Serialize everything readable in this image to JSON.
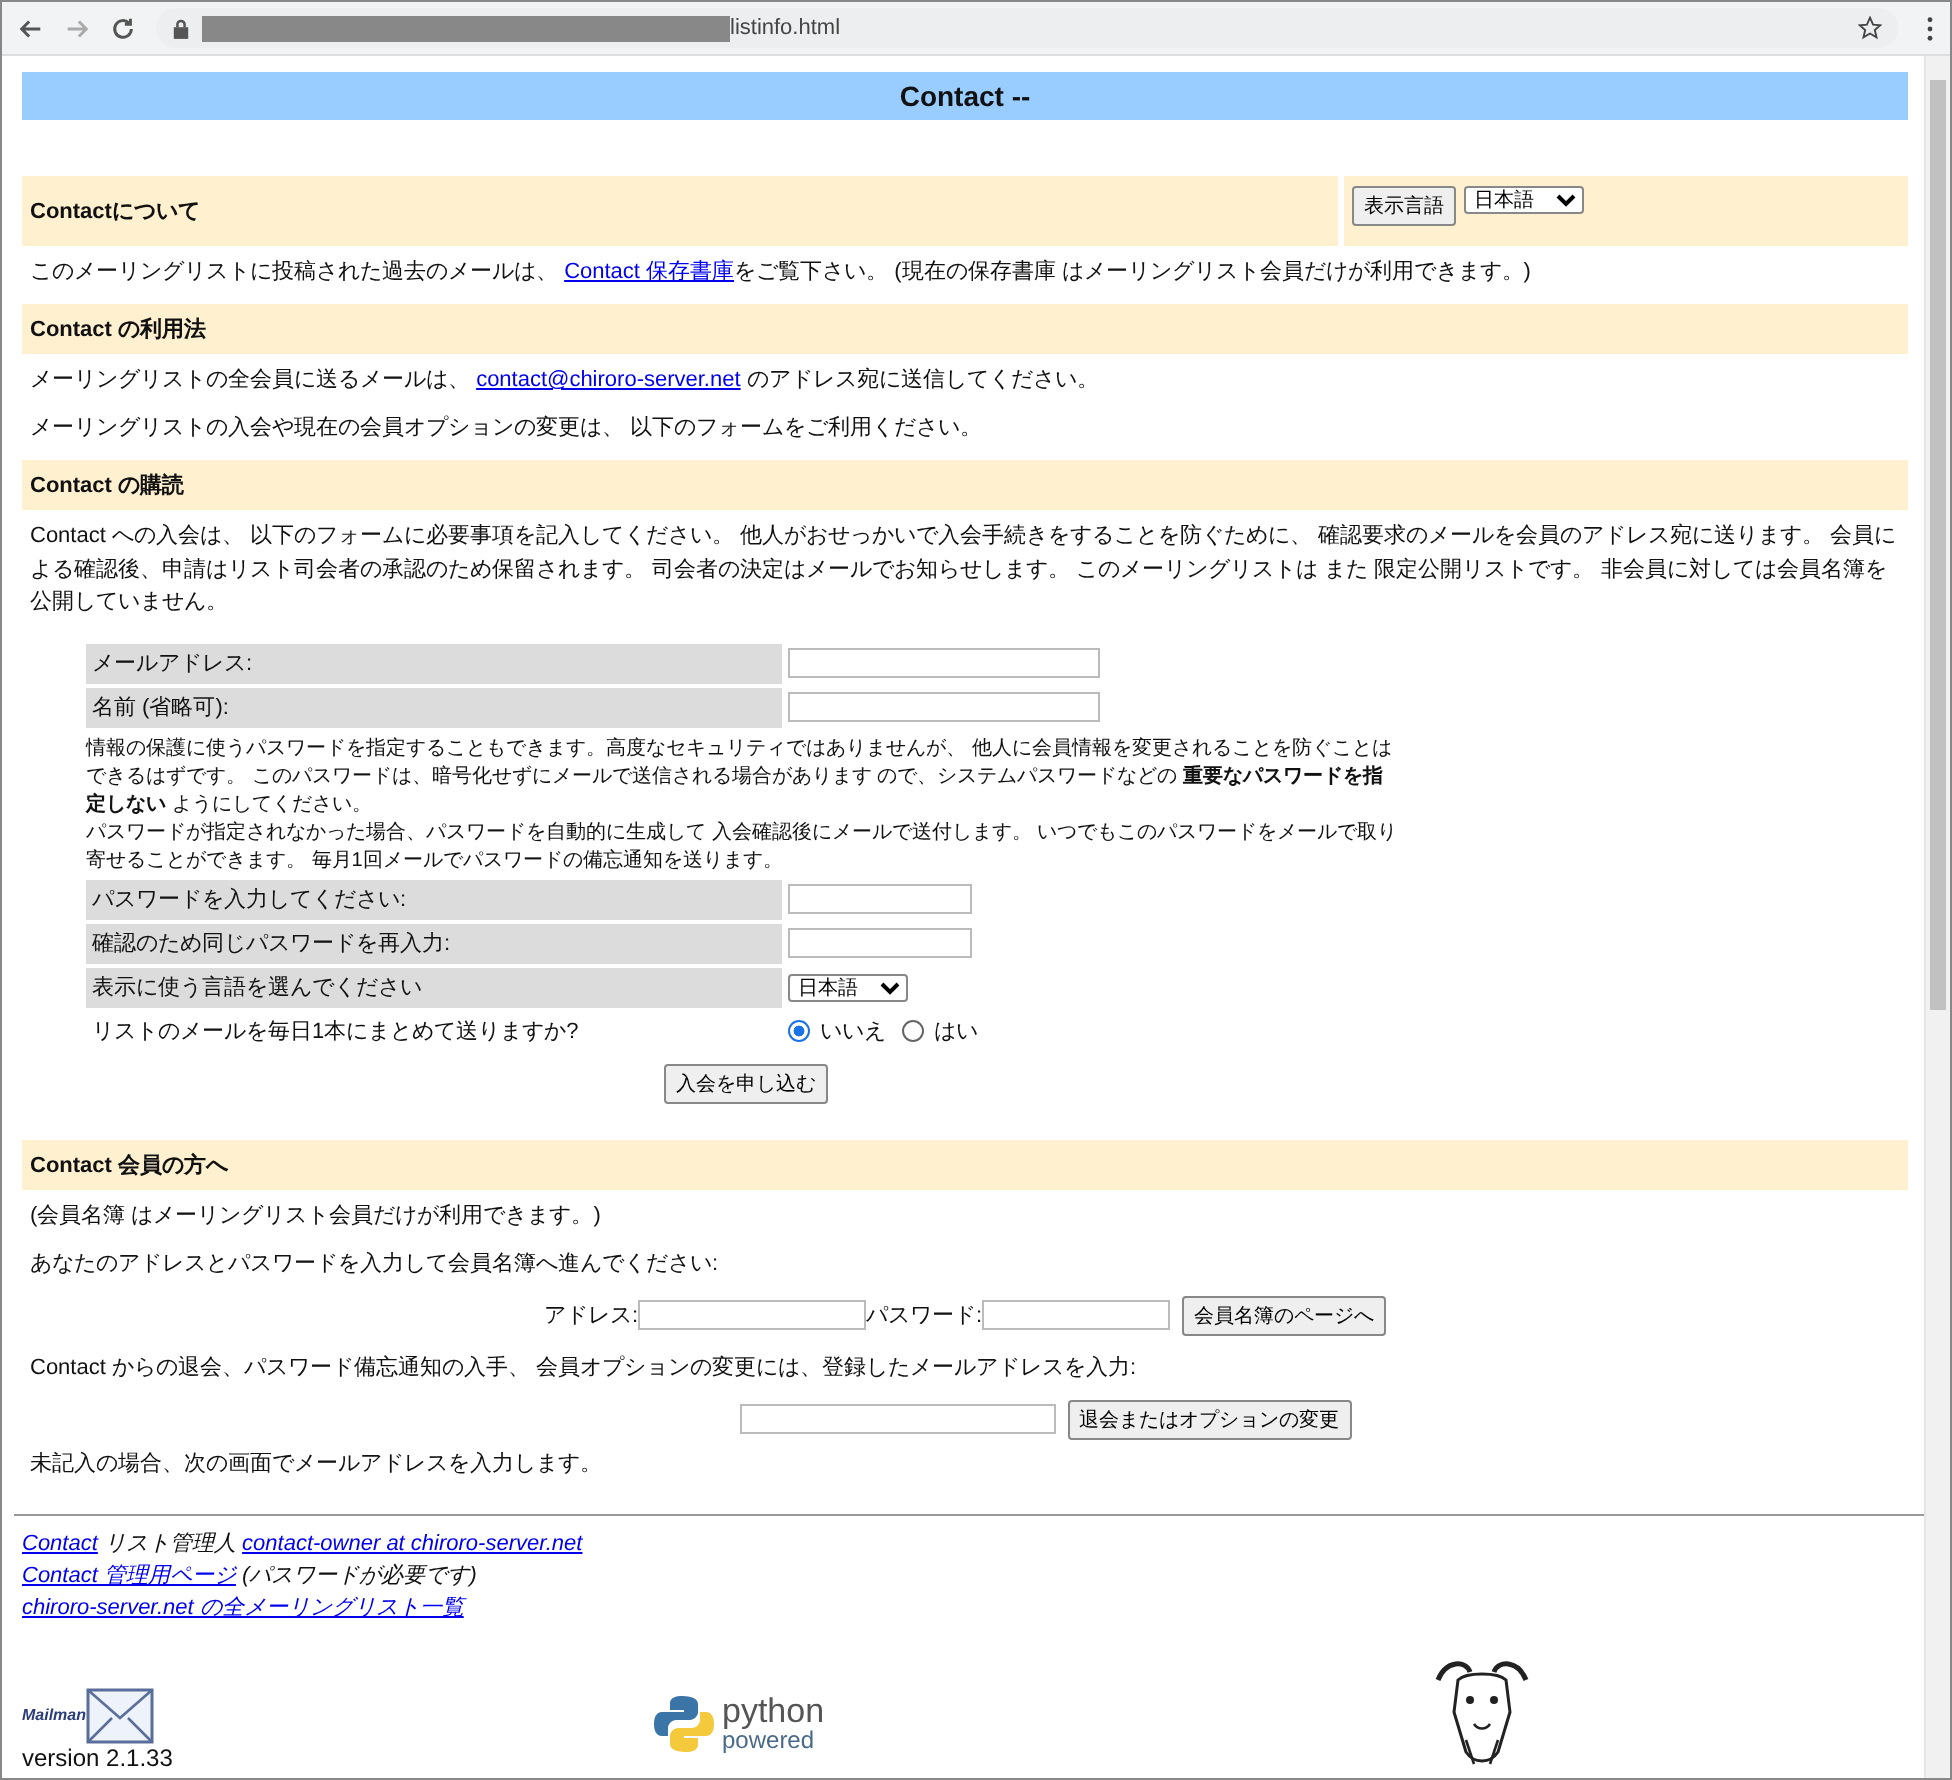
{
  "browser": {
    "url": "listinfo.html"
  },
  "header_title": "Contact --",
  "about": {
    "heading": "Contactについて",
    "language_button": "表示言語",
    "language_select": "日本語",
    "before": "このメーリングリストに投稿された過去のメールは、 ",
    "link": "Contact 保存書庫",
    "after": "をご覧下さい。 (現在の保存書庫 はメーリングリスト会員だけが利用できます。)"
  },
  "usage": {
    "heading": "Contact の利用法",
    "before": "メーリングリストの全会員に送るメールは、 ",
    "link": "contact@chiroro-server.net",
    "after": " のアドレス宛に送信してください。",
    "text": "メーリングリストの入会や現在の会員オプションの変更は、 以下のフォームをご利用ください。"
  },
  "subscribe": {
    "heading": "Contact の購読",
    "intro": "Contact への入会は、 以下のフォームに必要事項を記入してください。 他人がおせっかいで入会手続きをすることを防ぐために、 確認要求のメールを会員のアドレス宛に送ります。 会員による確認後、申請はリスト司会者の承認のため保留されます。 司会者の決定はメールでお知らせします。 このメーリングリストは また 限定公開リストです。 非会員に対しては会員名簿を公開していません。",
    "rows": [
      {
        "kind": "text",
        "label": "メールアドレス:"
      },
      {
        "kind": "text",
        "label": "名前 (省略可):"
      },
      {
        "kind": "note",
        "paragraphs": [
          "情報の保護に使うパスワードを指定することもできます。高度なセキュリティではありませんが、 他人に会員情報を変更されることを防ぐことはできるはずです。 このパスワードは、暗号化せずにメールで送信される場合があります ので、システムパスワードなどの **重要なパスワードを指定しない** ようにしてください。",
          "パスワードが指定されなかった場合、パスワードを自動的に生成して 入会確認後にメールで送付します。 いつでもこのパスワードをメールで取り寄せることができます。 毎月1回メールでパスワードの備忘通知を送ります。"
        ]
      },
      {
        "kind": "password",
        "label": "パスワードを入力してください:"
      },
      {
        "kind": "password",
        "label": "確認のため同じパスワードを再入力:"
      },
      {
        "kind": "select",
        "label": "表示に使う言語を選んでください",
        "value": "日本語"
      },
      {
        "kind": "radio",
        "label": "リストのメールを毎日1本にまとめて送りますか?",
        "options": [
          {
            "label": "いいえ",
            "selected": true
          },
          {
            "label": "はい",
            "selected": false
          }
        ]
      }
    ],
    "submit": "入会を申し込む"
  },
  "members": {
    "heading": "Contact 会員の方へ",
    "note": "(会員名簿 はメーリングリスト会員だけが利用できます。)",
    "text": "あなたのアドレスとパスワードを入力して会員名簿へ進んでください:",
    "address_label": "アドレス:",
    "password_label": "パスワード:",
    "roster_button": "会員名簿のページへ",
    "unsub_text": "Contact からの退会、パスワード備忘通知の入手、 会員オプションの変更には、登録したメールアドレスを入力:",
    "unsub_button": "退会またはオプションの変更",
    "unsub_hint": "未記入の場合、次の画面でメールアドレスを入力します。"
  },
  "footer": {
    "lines": [
      {
        "parts": [
          {
            "text": "Contact",
            "link": true
          },
          {
            "text": " リスト管理人 ",
            "link": false
          },
          {
            "text": "contact-owner at chiroro-server.net",
            "link": true
          }
        ]
      },
      {
        "parts": [
          {
            "text": "Contact 管理用ページ",
            "link": true
          },
          {
            "text": " (パスワードが必要です)",
            "link": false
          }
        ]
      },
      {
        "parts": [
          {
            "text": "chiroro-server.net の全メーリングリスト一覧",
            "link": true
          }
        ]
      }
    ],
    "mailman_logo": "Mailman",
    "version": "version 2.1.33",
    "python_logo": "python",
    "python_sub": "powered"
  }
}
